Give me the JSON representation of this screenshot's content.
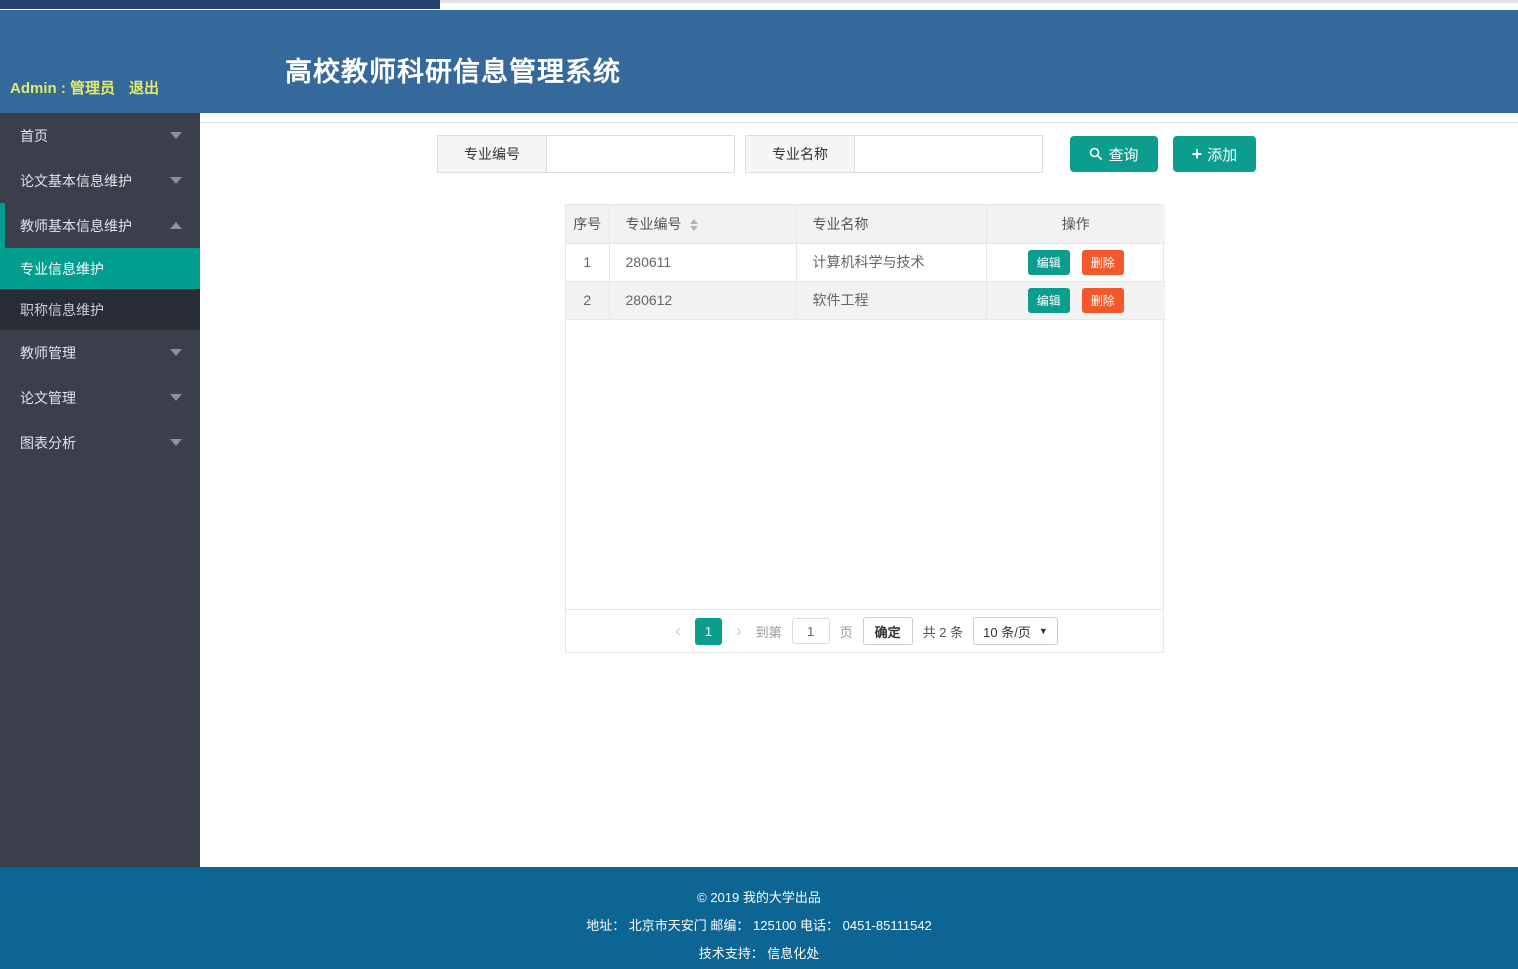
{
  "header": {
    "admin_label": "Admin : 管理员",
    "logout_label": "退出",
    "title": "高校教师科研信息管理系统"
  },
  "sidebar": {
    "items": [
      {
        "label": "首页"
      },
      {
        "label": "论文基本信息维护"
      },
      {
        "label": "教师基本信息维护"
      },
      {
        "label": "专业信息维护"
      },
      {
        "label": "职称信息维护"
      },
      {
        "label": "教师管理"
      },
      {
        "label": "论文管理"
      },
      {
        "label": "图表分析"
      }
    ]
  },
  "search": {
    "code_label": "专业编号",
    "code_value": "",
    "name_label": "专业名称",
    "name_value": "",
    "query_label": "查询",
    "plus_icon": "+",
    "add_label": "添加"
  },
  "table": {
    "columns": [
      "序号",
      "专业编号",
      "专业名称",
      "操作"
    ],
    "rows": [
      {
        "no": "1",
        "code": "280611",
        "name": "计算机科学与技术"
      },
      {
        "no": "2",
        "code": "280612",
        "name": "软件工程"
      }
    ],
    "edit_label": "编辑",
    "delete_label": "删除"
  },
  "pagination": {
    "prev": "‹",
    "page": "1",
    "next": "›",
    "goto_label": "到第",
    "goto_value": "1",
    "page_unit": "页",
    "confirm_label": "确定",
    "total_label": "共 2 条",
    "per_page_label": "10 条/页",
    "caret": "▼"
  },
  "footer": {
    "line1": "© 2019 我的大学出品",
    "line2": "地址： 北京市天安门 邮编： 125100 电话： 0451-85111542",
    "line3": "技术支持： 信息化处"
  },
  "colors": {
    "header_blue": "#35689b",
    "footer_blue": "#0c6593",
    "sidebar_dark": "#3a3f4b",
    "submenu_dark": "#272c35",
    "accent_teal": "#0b9d8e",
    "active_teal": "#009e8f",
    "delete_orange": "#f4572c",
    "admin_yellow": "#e2e96f"
  }
}
